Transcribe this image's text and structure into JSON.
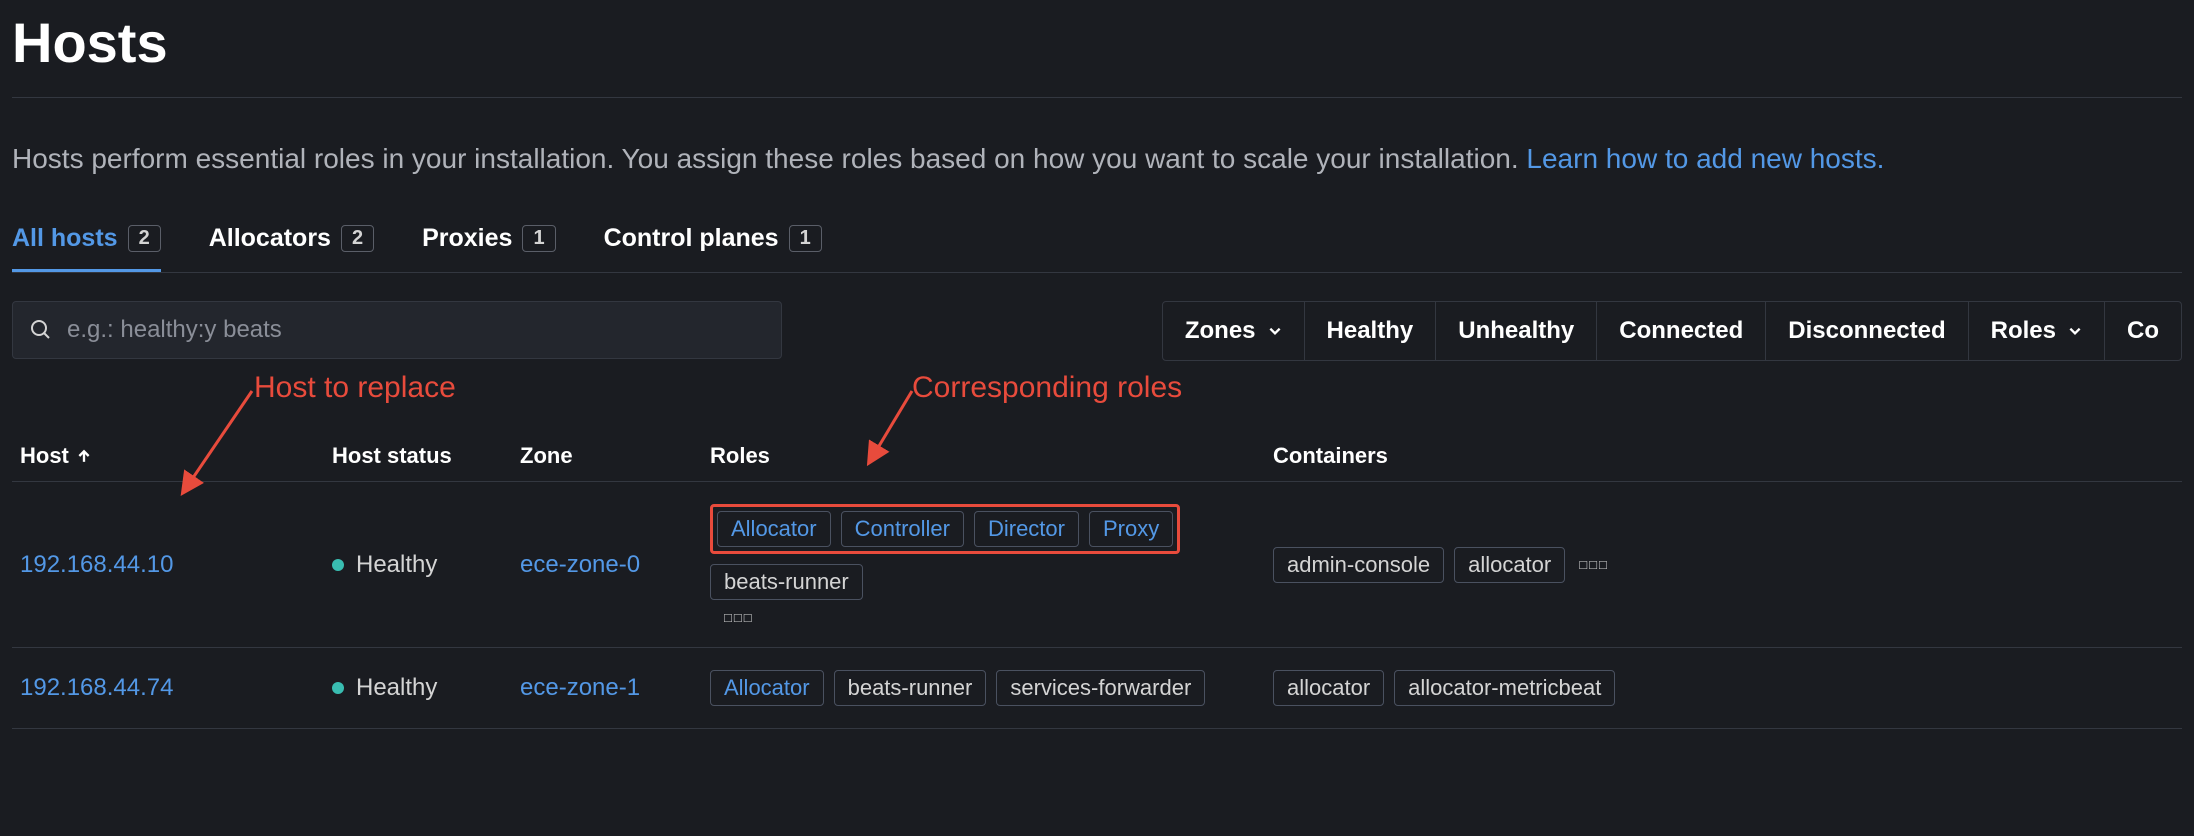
{
  "page": {
    "title": "Hosts",
    "description": "Hosts perform essential roles in your installation. You assign these roles based on how you want to scale your installation. ",
    "learn_link": "Learn how to add new hosts."
  },
  "tabs": [
    {
      "label": "All hosts",
      "count": "2",
      "active": true
    },
    {
      "label": "Allocators",
      "count": "2",
      "active": false
    },
    {
      "label": "Proxies",
      "count": "1",
      "active": false
    },
    {
      "label": "Control planes",
      "count": "1",
      "active": false
    }
  ],
  "search": {
    "placeholder": "e.g.: healthy:y beats"
  },
  "filters": [
    {
      "label": "Zones",
      "dropdown": true
    },
    {
      "label": "Healthy",
      "dropdown": false
    },
    {
      "label": "Unhealthy",
      "dropdown": false
    },
    {
      "label": "Connected",
      "dropdown": false
    },
    {
      "label": "Disconnected",
      "dropdown": false
    },
    {
      "label": "Roles",
      "dropdown": true
    },
    {
      "label": "Co",
      "dropdown": false
    }
  ],
  "annotations": {
    "host_replace": "Host to replace",
    "roles": "Corresponding roles"
  },
  "columns": {
    "host": "Host",
    "status": "Host status",
    "zone": "Zone",
    "roles": "Roles",
    "containers": "Containers"
  },
  "rows": [
    {
      "host": "192.168.44.10",
      "status": "Healthy",
      "zone": "ece-zone-0",
      "roles_highlighted": [
        "Allocator",
        "Controller",
        "Director",
        "Proxy"
      ],
      "roles_plain": [
        "beats-runner"
      ],
      "roles_more": "□□□",
      "containers": [
        "admin-console",
        "allocator"
      ],
      "containers_more": "□□□"
    },
    {
      "host": "192.168.44.74",
      "status": "Healthy",
      "zone": "ece-zone-1",
      "roles_highlighted": [],
      "roles_link": [
        "Allocator"
      ],
      "roles_plain": [
        "beats-runner",
        "services-forwarder"
      ],
      "roles_more": "",
      "containers": [
        "allocator",
        "allocator-metricbeat"
      ],
      "containers_more": ""
    }
  ]
}
